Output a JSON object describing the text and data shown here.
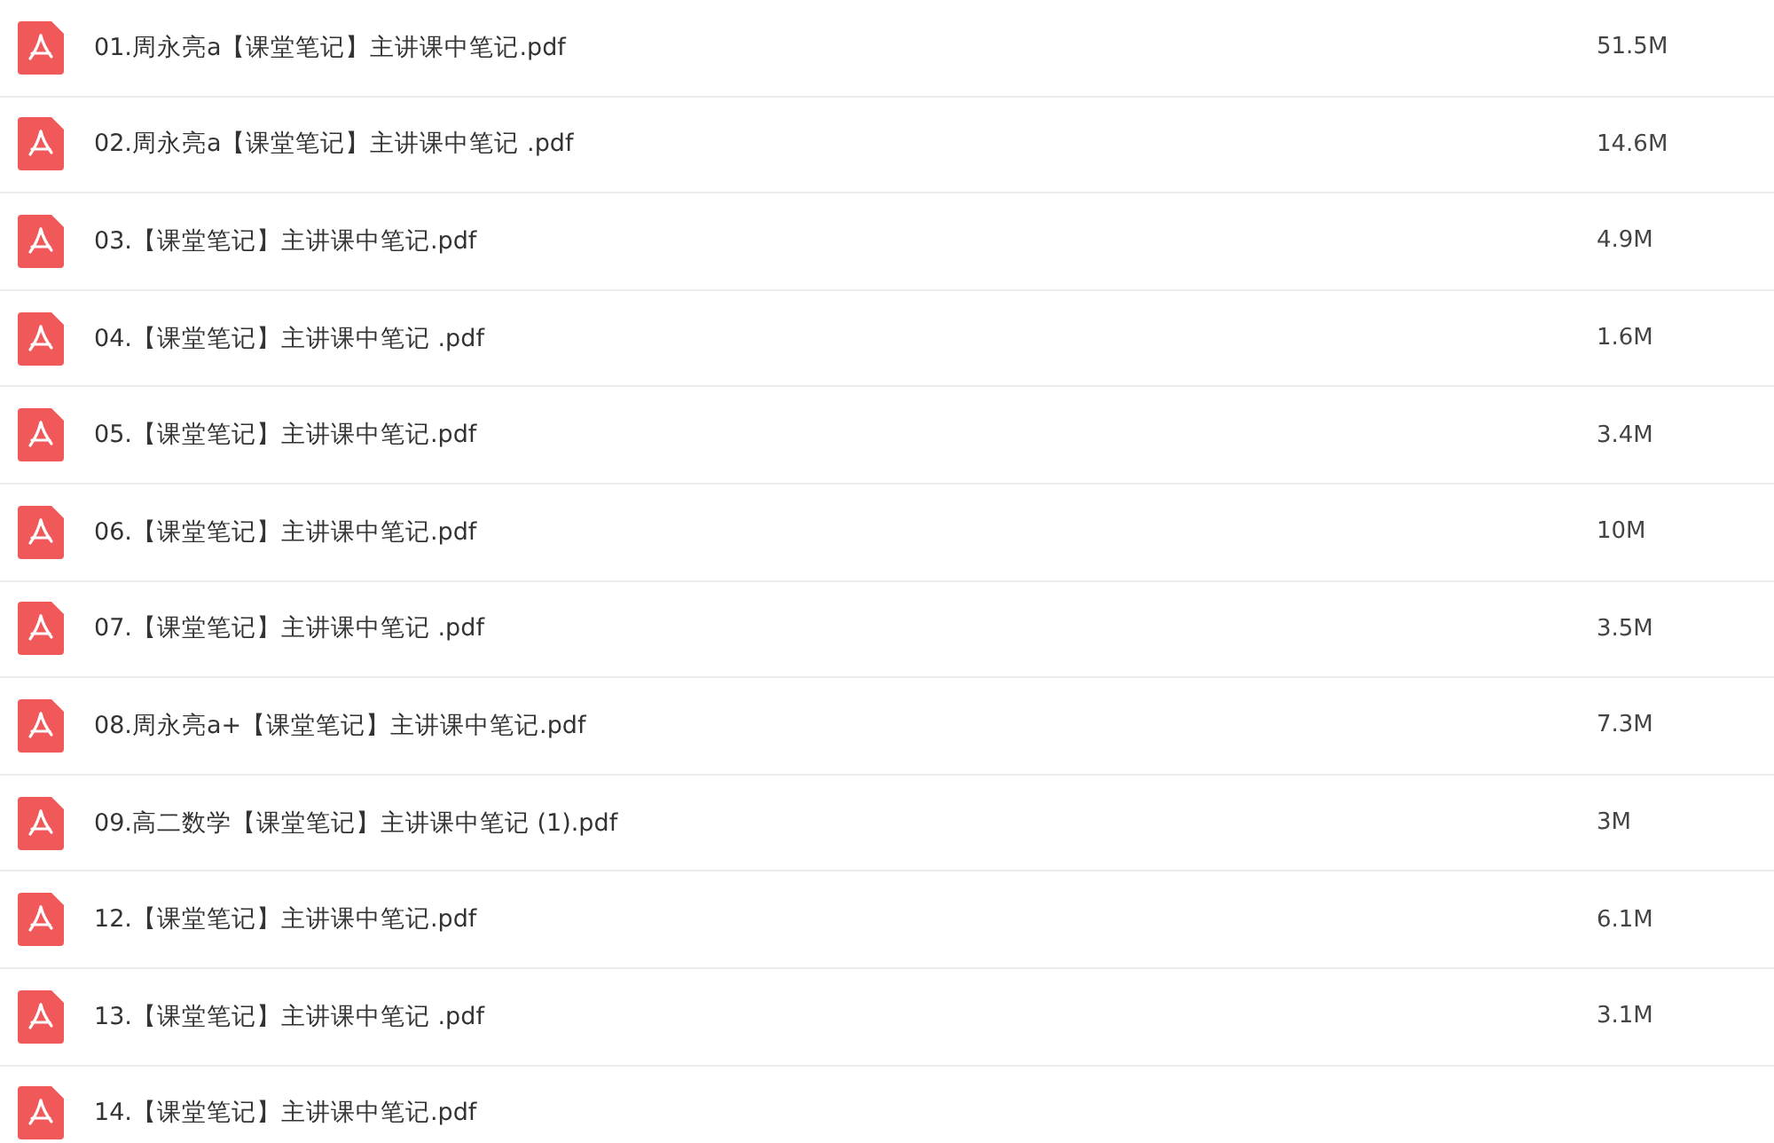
{
  "files": [
    {
      "name": "01.周永亮a【课堂笔记】主讲课中笔记.pdf",
      "size": "51.5M"
    },
    {
      "name": "02.周永亮a【课堂笔记】主讲课中笔记 .pdf",
      "size": "14.6M"
    },
    {
      "name": "03.【课堂笔记】主讲课中笔记.pdf",
      "size": "4.9M"
    },
    {
      "name": "04.【课堂笔记】主讲课中笔记 .pdf",
      "size": "1.6M"
    },
    {
      "name": "05.【课堂笔记】主讲课中笔记.pdf",
      "size": "3.4M"
    },
    {
      "name": "06.【课堂笔记】主讲课中笔记.pdf",
      "size": "10M"
    },
    {
      "name": "07.【课堂笔记】主讲课中笔记 .pdf",
      "size": "3.5M"
    },
    {
      "name": "08.周永亮a+【课堂笔记】主讲课中笔记.pdf",
      "size": "7.3M"
    },
    {
      "name": "09.高二数学【课堂笔记】主讲课中笔记 (1).pdf",
      "size": "3M"
    },
    {
      "name": "12.【课堂笔记】主讲课中笔记.pdf",
      "size": "6.1M"
    },
    {
      "name": "13.【课堂笔记】主讲课中笔记 .pdf",
      "size": "3.1M"
    },
    {
      "name": "14.【课堂笔记】主讲课中笔记.pdf"
    }
  ]
}
